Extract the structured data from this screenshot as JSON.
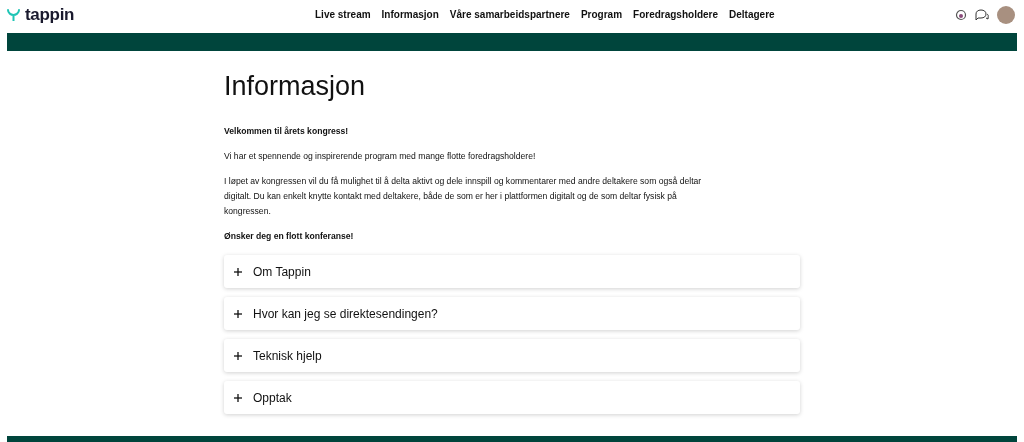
{
  "header": {
    "logo": "tappin",
    "nav": [
      {
        "label": "Live stream",
        "selected": false
      },
      {
        "label": "Informasjon",
        "selected": false
      },
      {
        "label": "Våre samarbeidspartnere",
        "selected": false
      },
      {
        "label": "Program",
        "selected": false
      },
      {
        "label": "Foredragsholdere",
        "selected": false
      },
      {
        "label": "Deltagere",
        "selected": false
      }
    ]
  },
  "page": {
    "title": "Informasjon",
    "paragraphs": [
      {
        "kind": "bold",
        "text": "Velkommen til årets kongress!"
      },
      {
        "kind": "normal",
        "text": "Vi har et spennende og inspirerende program med mange flotte foredragsholdere!"
      },
      {
        "kind": "normal",
        "text": "I løpet av kongressen vil du få mulighet til å delta aktivt og dele innspill og kommentarer med andre deltakere som også deltar digitalt. Du kan enkelt knytte kontakt med deltakere, både de som er her i plattformen digitalt og de som deltar fysisk på kongressen."
      },
      {
        "kind": "bold",
        "text": "Ønsker deg en flott konferanse!"
      }
    ],
    "accordion": [
      {
        "title": "Om Tappin",
        "expanded": false
      },
      {
        "title": "Hvor kan jeg se direktesendingen?",
        "expanded": false
      },
      {
        "title": "Teknisk hjelp",
        "expanded": false
      },
      {
        "title": "Opptak",
        "expanded": false
      }
    ]
  }
}
